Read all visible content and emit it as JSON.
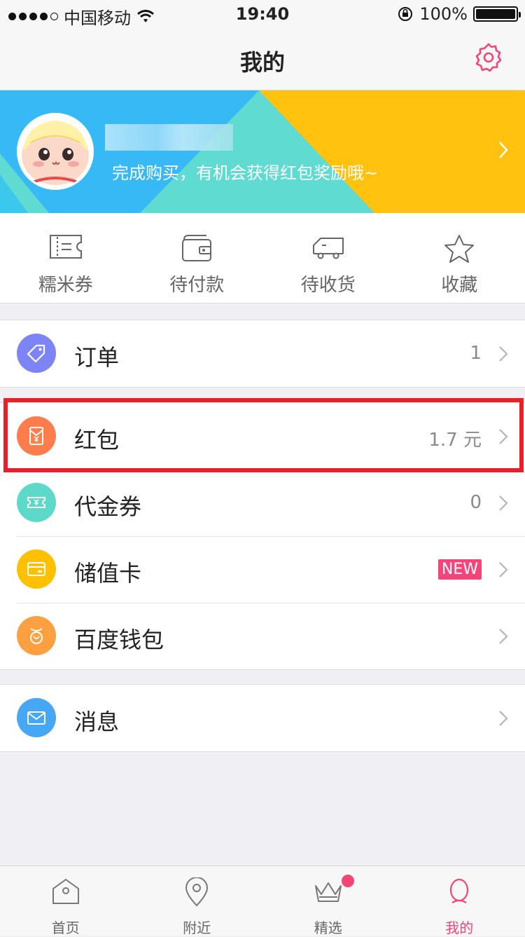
{
  "status_bar": {
    "carrier": "中国移动",
    "time": "19:40",
    "battery": "100%"
  },
  "nav": {
    "title": "我的"
  },
  "profile": {
    "subtitle": "完成购买，有机会获得红包奖励哦~"
  },
  "quick_actions": [
    {
      "label": "糯米券",
      "icon": "ticket-icon"
    },
    {
      "label": "待付款",
      "icon": "wallet-icon"
    },
    {
      "label": "待收货",
      "icon": "truck-icon"
    },
    {
      "label": "收藏",
      "icon": "star-icon"
    }
  ],
  "menu": {
    "order": {
      "label": "订单",
      "value": "1",
      "color": "#7d84f5"
    },
    "redpacket": {
      "label": "红包",
      "value": "1.7 元",
      "color": "#ff7d4d"
    },
    "voucher": {
      "label": "代金券",
      "value": "0",
      "color": "#5cd9c8"
    },
    "storedcard": {
      "label": "储值卡",
      "badge": "NEW",
      "color": "#ffc000"
    },
    "wallet": {
      "label": "百度钱包",
      "color": "#ffa040"
    },
    "message": {
      "label": "消息",
      "color": "#46a7f5"
    }
  },
  "tabbar": {
    "items": [
      {
        "label": "首页"
      },
      {
        "label": "附近"
      },
      {
        "label": "精选"
      },
      {
        "label": "我的"
      }
    ]
  },
  "colors": {
    "accent": "#f5447a",
    "highlight_box": "#e8202b"
  }
}
